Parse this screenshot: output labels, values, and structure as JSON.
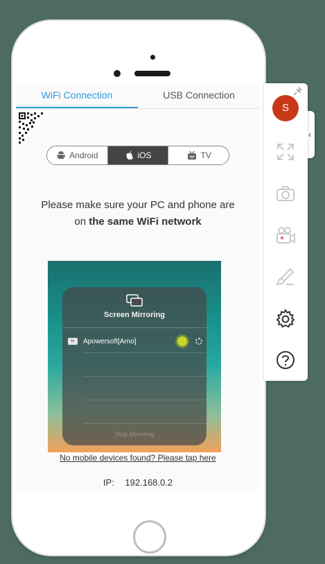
{
  "tabs": {
    "wifi": "WiFi Connection",
    "usb": "USB Connection"
  },
  "platforms": {
    "android": "Android",
    "ios": "iOS",
    "tv": "TV"
  },
  "message": {
    "line1": "Please make sure your PC and phone are on ",
    "bold": "the same WiFi network"
  },
  "preview": {
    "title": "Screen Mirroring",
    "device": "Apowersoft[Arno]",
    "tv_badge": "tv",
    "stop": "Stop Mirroring"
  },
  "help_link": "No mobile devices found? Please tap here",
  "ip": {
    "label": "IP:",
    "value": "192.168.0.2"
  },
  "toolbar": {
    "avatar_letter": "S",
    "collapse_glyph": "‹",
    "icons": [
      "fullscreen-icon",
      "camera-icon",
      "record-icon",
      "brush-icon",
      "settings-icon",
      "help-icon"
    ]
  },
  "colors": {
    "accent": "#2f9be0",
    "avatar": "#c73818",
    "background": "#4d6b62"
  }
}
